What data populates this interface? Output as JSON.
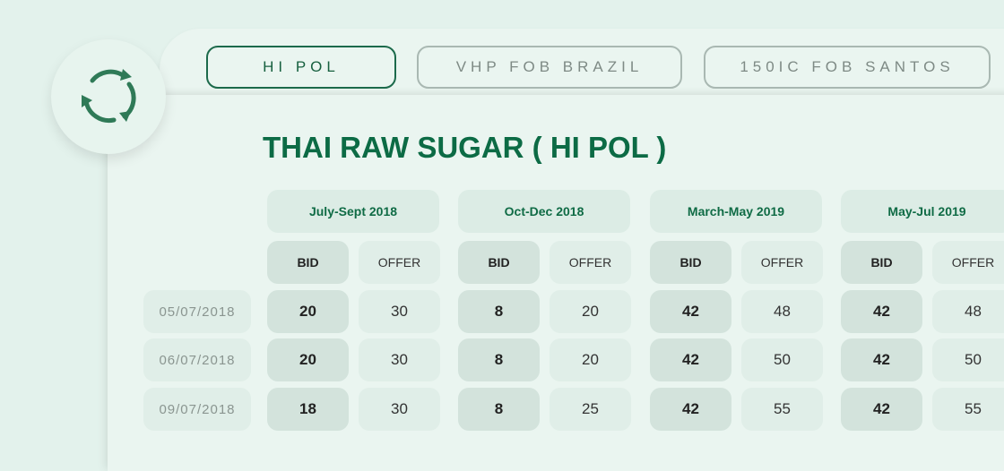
{
  "tabs": [
    {
      "label": "HI POL",
      "active": true
    },
    {
      "label": "VHP FOB BRAZIL",
      "active": false
    },
    {
      "label": "150IC FOB SANTOS",
      "active": false
    }
  ],
  "refresh_icon": "refresh-icon",
  "title": "THAI RAW SUGAR ( HI POL )",
  "table": {
    "quarters": [
      "July-Sept 2018",
      "Oct-Dec 2018",
      "March-May 2019",
      "May-Jul 2019"
    ],
    "bid_label": "BID",
    "offer_label": "OFFER",
    "rows": [
      {
        "date": "05/07/2018",
        "values": [
          [
            "20",
            "30"
          ],
          [
            "8",
            "20"
          ],
          [
            "42",
            "48"
          ],
          [
            "42",
            "48"
          ]
        ]
      },
      {
        "date": "06/07/2018",
        "values": [
          [
            "20",
            "30"
          ],
          [
            "8",
            "20"
          ],
          [
            "42",
            "50"
          ],
          [
            "42",
            "50"
          ]
        ]
      },
      {
        "date": "09/07/2018",
        "values": [
          [
            "18",
            "30"
          ],
          [
            "8",
            "25"
          ],
          [
            "42",
            "55"
          ],
          [
            "42",
            "55"
          ]
        ]
      }
    ]
  },
  "colors": {
    "brand_green": "#0c6b45",
    "background": "#e3f2ec",
    "bid_cell": "#d3e3dc",
    "offer_cell": "#e0eee8"
  }
}
